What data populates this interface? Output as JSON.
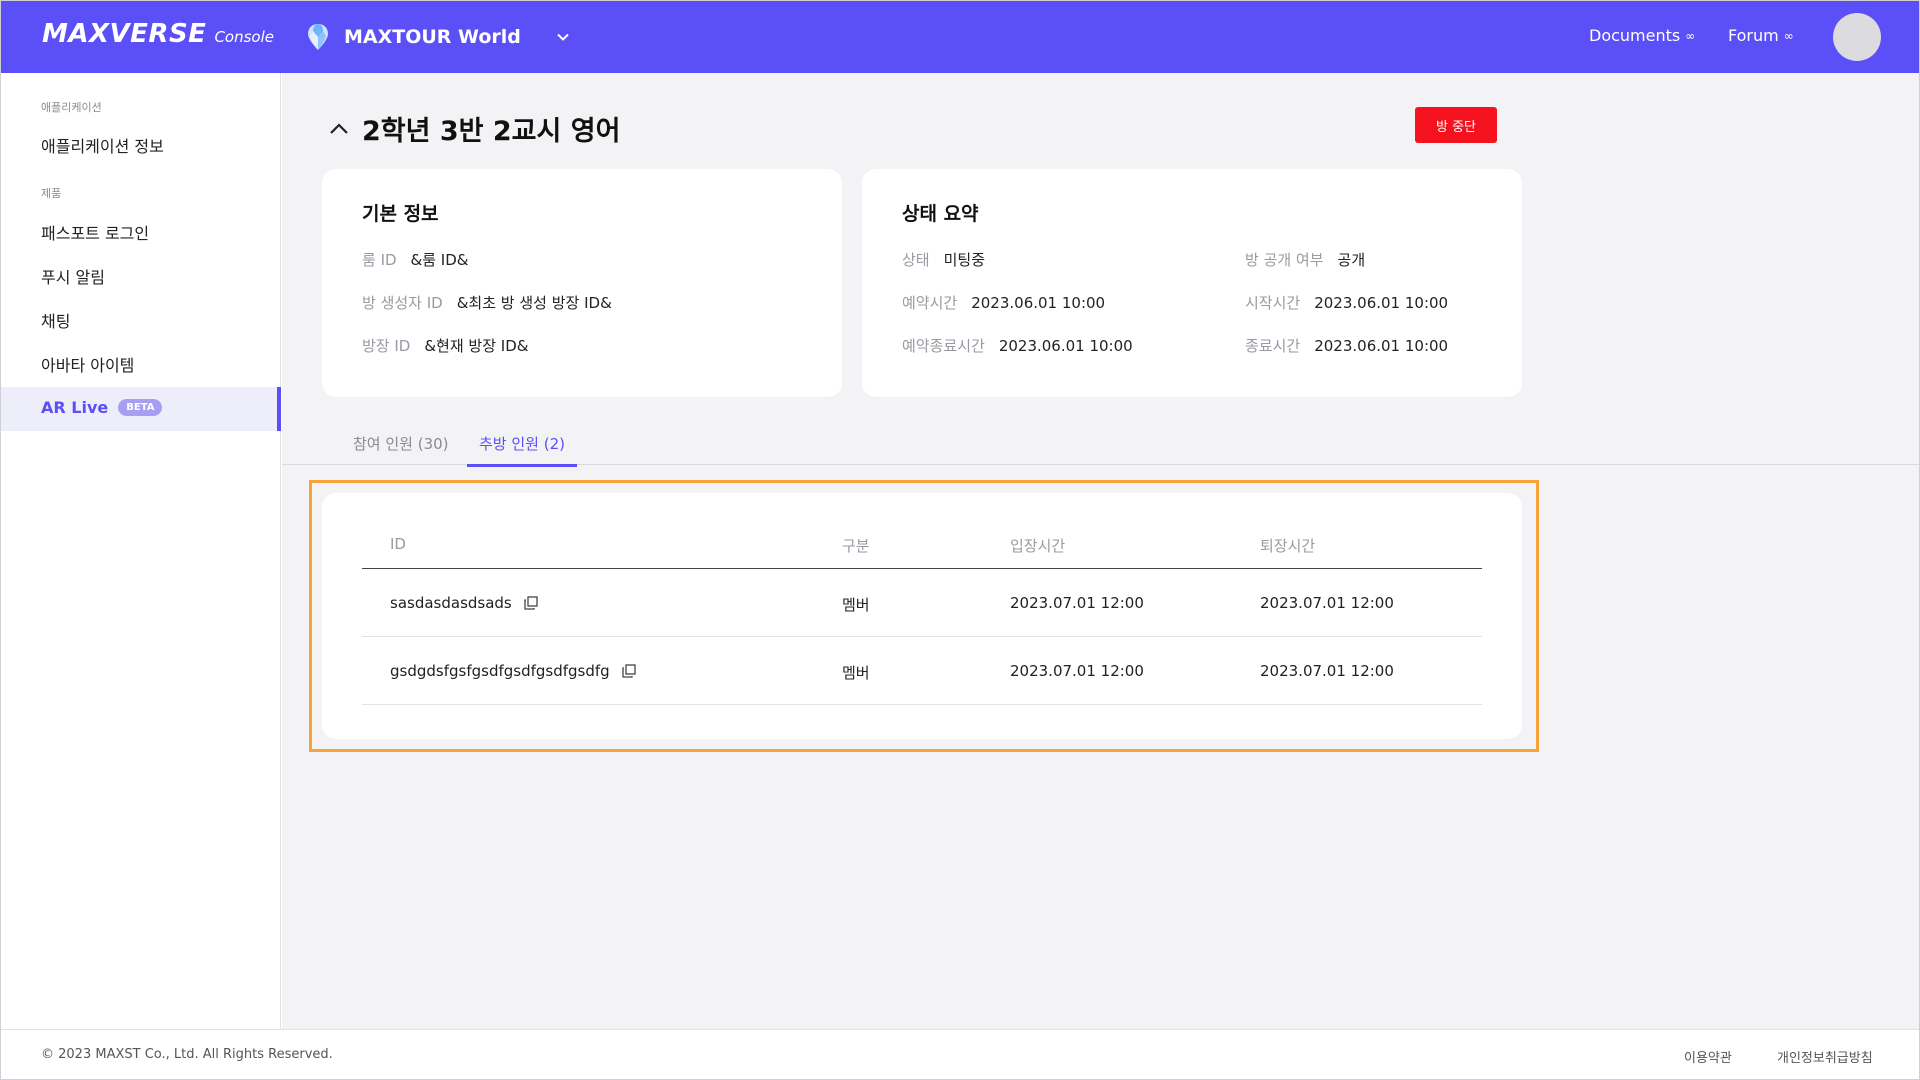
{
  "header": {
    "logo_main": "MAXVERSE",
    "logo_sub": "Console",
    "world_name": "MAXTOUR World",
    "links": {
      "documents": "Documents",
      "forum": "Forum",
      "external_symbol": "∞"
    },
    "brand_color": "#5b4ff8"
  },
  "sidebar": {
    "section_app": "애플리케이션",
    "item_app_info": "애플리케이션 정보",
    "section_product": "제품",
    "item_passport": "패스포트 로그인",
    "item_push": "푸시 알림",
    "item_chat": "채팅",
    "item_avatar": "아바타 아이템",
    "item_arlive": "AR Live",
    "beta_badge": "BETA"
  },
  "page": {
    "title": "2학년 3반 2교시 영어",
    "stop_button": "방 중단"
  },
  "basic_info": {
    "title": "기본 정보",
    "room_id_label": "룸 ID",
    "room_id_value": "&룸 ID&",
    "creator_label": "방 생성자 ID",
    "creator_value": "&최초 방 생성 방장 ID&",
    "host_label": "방장 ID",
    "host_value": "&현재 방장 ID&"
  },
  "status_summary": {
    "title": "상태 요약",
    "status_label": "상태",
    "status_value": "미팅중",
    "public_label": "방 공개 여부",
    "public_value": "공개",
    "reserved_label": "예약시간",
    "reserved_value": "2023.06.01 10:00",
    "start_label": "시작시간",
    "start_value": "2023.06.01 10:00",
    "reserved_end_label": "예약종료시간",
    "reserved_end_value": "2023.06.01 10:00",
    "end_label": "종료시간",
    "end_value": "2023.06.01 10:00"
  },
  "tabs": {
    "participants": "참여 인원 (30)",
    "kicked": "추방 인원 (2)"
  },
  "table": {
    "headers": {
      "id": "ID",
      "type": "구분",
      "enter": "입장시간",
      "exit": "퇴장시간"
    },
    "rows": [
      {
        "id": "sasdasdasdsads",
        "type": "멤버",
        "enter": "2023.07.01  12:00",
        "exit": "2023.07.01  12:00"
      },
      {
        "id": "gsdgdsfgsfgsdfgsdfgsdfgsdfg",
        "type": "멤버",
        "enter": "2023.07.01  12:00",
        "exit": "2023.07.01  12:00"
      }
    ]
  },
  "footer": {
    "copyright": "© 2023 MAXST Co., Ltd. All Rights Reserved.",
    "terms": "이용약관",
    "privacy": "개인정보취급방침"
  }
}
